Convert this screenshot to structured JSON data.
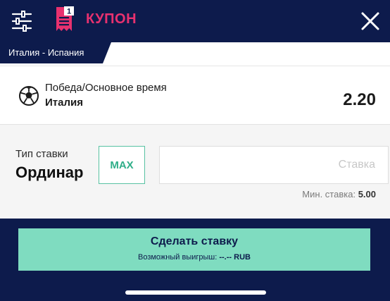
{
  "header": {
    "title": "КУПОН",
    "coupon_count": "1",
    "filter_icon": "sliders-icon",
    "close_icon": "close-icon",
    "accent_color": "#e8316f",
    "background_color": "#0d1b4c"
  },
  "match": {
    "name": "Италия - Испания"
  },
  "bet": {
    "market": "Победа/Основное время",
    "selection": "Италия",
    "odds": "2.20",
    "sport_icon": "soccer-ball-icon"
  },
  "stake": {
    "type_label": "Тип ставки",
    "type_value": "Ординар",
    "max_label": "MAX",
    "input_placeholder": "Ставка",
    "input_value": "",
    "min_label": "Мин. ставка:",
    "min_value": "5.00"
  },
  "footer": {
    "button_label": "Сделать ставку",
    "winnings_label": "Возможный выигрыш:",
    "winnings_value": "--.--",
    "currency": "RUB",
    "button_color": "#7fdcc0"
  }
}
